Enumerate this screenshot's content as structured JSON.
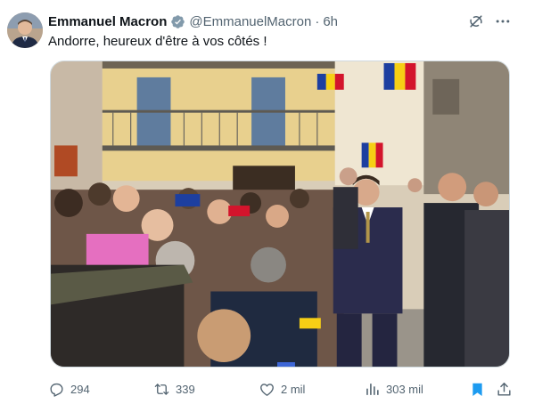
{
  "tweet": {
    "author_name": "Emmanuel Macron",
    "handle": "@EmmanuelMacron",
    "separator": "·",
    "time": "6h",
    "text": "Andorre, heureux d'être à vos côtés !",
    "verified": true,
    "avatar_icon": "avatar-photo"
  },
  "actions": {
    "replies": "294",
    "reposts": "339",
    "likes": "2 mil",
    "views": "303 mil",
    "bookmarked": true
  },
  "colors": {
    "text": "#0f1419",
    "secondary": "#536471",
    "verified_badge": "#829aab",
    "bookmark_active": "#1d9bf0",
    "border": "#cfd9de"
  },
  "icons": {
    "verified": "verified-badge-icon",
    "grok": "grok-icon",
    "more": "more-icon",
    "reply": "reply-icon",
    "repost": "repost-icon",
    "like": "heart-icon",
    "views": "views-chart-icon",
    "bookmark": "bookmark-icon",
    "share": "share-icon"
  }
}
